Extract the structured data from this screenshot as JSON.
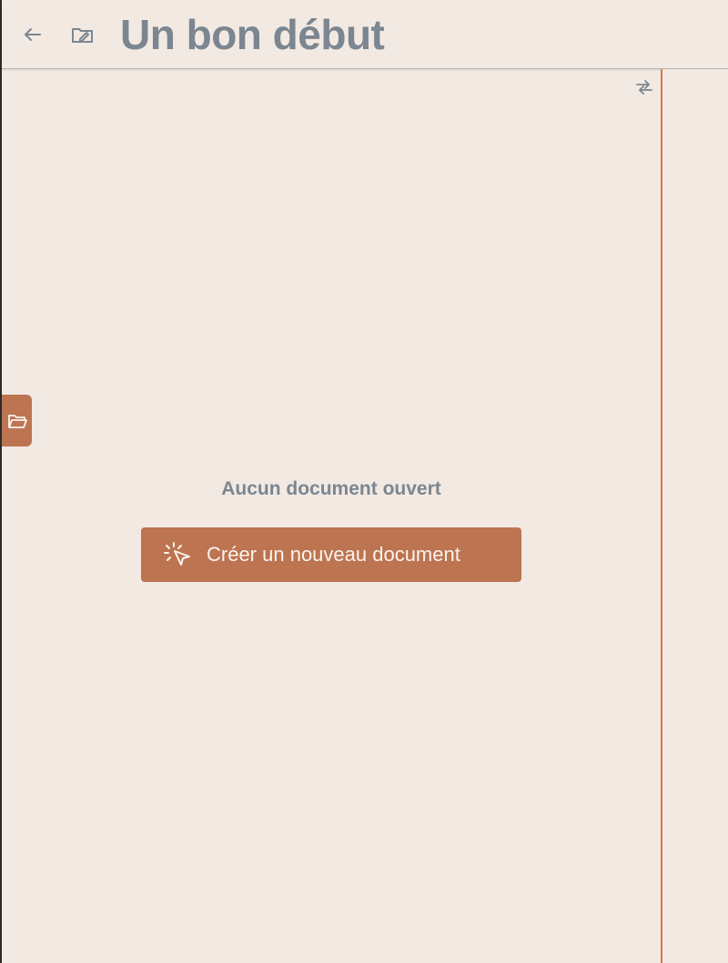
{
  "header": {
    "title": "Un bon début",
    "back_icon": "arrow-left-icon",
    "document_icon": "folder-edit-icon"
  },
  "sidebar": {
    "folder_tab_icon": "folder-open-icon"
  },
  "main": {
    "collapse_icon": "collapse-arrows-icon",
    "empty_message": "Aucun document ouvert",
    "create_button": {
      "label": "Créer un nouveau document",
      "icon": "cursor-click-icon"
    }
  },
  "colors": {
    "background": "#f2e9e3",
    "accent": "#bd7450",
    "accent_border": "#d87a3f",
    "muted_text": "#7b8690",
    "button_text": "#fbf3ee"
  }
}
